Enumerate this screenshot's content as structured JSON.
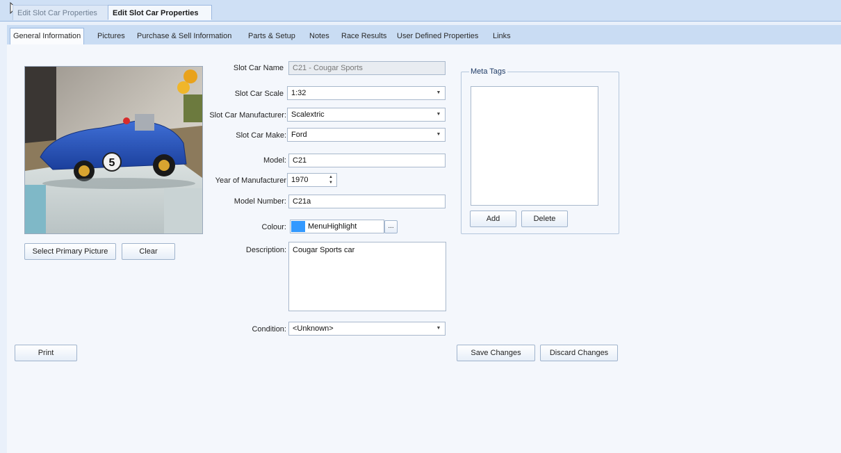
{
  "document_tabs": [
    {
      "label": "Edit Slot Car Properties"
    },
    {
      "label": "Edit Slot Car Properties"
    }
  ],
  "section_tabs": [
    {
      "label": "General Information"
    },
    {
      "label": "Pictures"
    },
    {
      "label": "Purchase & Sell Information"
    },
    {
      "label": "Parts & Setup"
    },
    {
      "label": "Notes"
    },
    {
      "label": "Race Results"
    },
    {
      "label": "User Defined Properties"
    },
    {
      "label": "Links"
    }
  ],
  "picture": {
    "select_label": "Select Primary Picture",
    "clear_label": "Clear",
    "car_number": "5"
  },
  "form": {
    "name": {
      "label": "Slot Car Name",
      "value": "C21 - Cougar Sports"
    },
    "scale": {
      "label": "Slot Car Scale",
      "value": "1:32"
    },
    "manufacturer": {
      "label": "Slot Car Manufacturer:",
      "value": "Scalextric"
    },
    "make": {
      "label": "Slot Car Make:",
      "value": "Ford"
    },
    "model": {
      "label": "Model:",
      "value": "C21"
    },
    "year": {
      "label": "Year of Manufacturer",
      "value": "1970"
    },
    "model_number": {
      "label": "Model Number:",
      "value": "C21a"
    },
    "colour": {
      "label": "Colour:",
      "value": "MenuHighlight",
      "swatch": "#3399ff",
      "picker_label": "..."
    },
    "description": {
      "label": "Description:",
      "value": "Cougar Sports car"
    },
    "condition": {
      "label": "Condition:",
      "value": "<Unknown>"
    }
  },
  "meta_tags": {
    "legend": "Meta Tags",
    "add_label": "Add",
    "delete_label": "Delete"
  },
  "actions": {
    "print_label": "Print",
    "save_label": "Save Changes",
    "discard_label": "Discard Changes"
  },
  "icons": {
    "dropdown": "chevron-down-icon",
    "spinner": "spin-updown-icon",
    "cursor": "pointer-cursor-icon"
  }
}
